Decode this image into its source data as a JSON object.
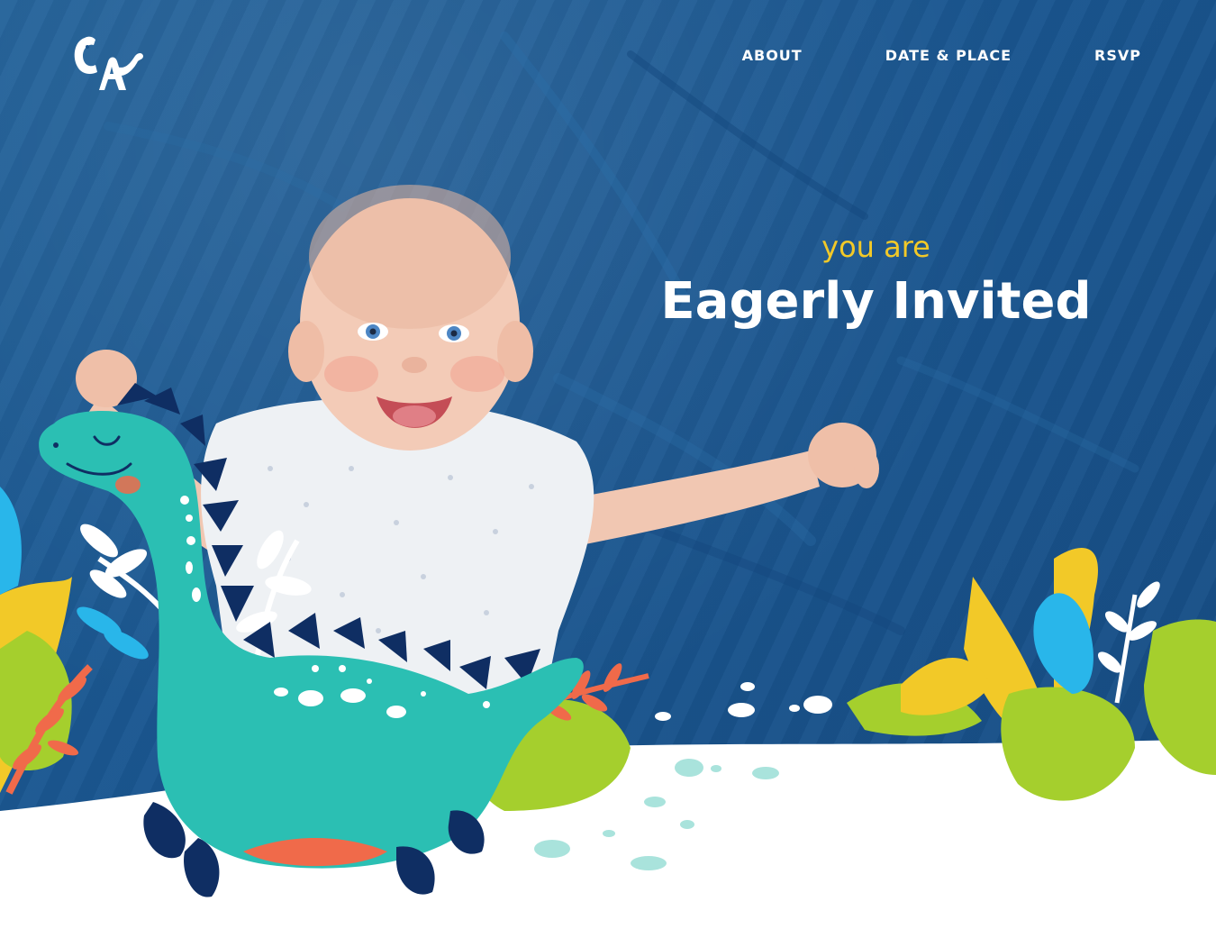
{
  "brand": {
    "logo_icon": "dino-monogram-logo-icon"
  },
  "nav": {
    "items": [
      {
        "label": "ABOUT"
      },
      {
        "label": "DATE & PLACE"
      },
      {
        "label": "RSVP"
      }
    ]
  },
  "hero": {
    "subtitle": "you are",
    "title": "Eagerly Invited",
    "photo": "smiling-baby-on-blue-sheet",
    "illustration": "dinosaur-with-jungle-leaves"
  },
  "colors": {
    "background_blue": "#1a5690",
    "accent_yellow": "#f2c928",
    "dino_teal": "#2bbfb3",
    "dino_navy": "#0f2e63",
    "leaf_green": "#a5cf2d",
    "leaf_blue": "#29b6ea",
    "leaf_orange": "#f06a4a",
    "text_white": "#ffffff"
  }
}
